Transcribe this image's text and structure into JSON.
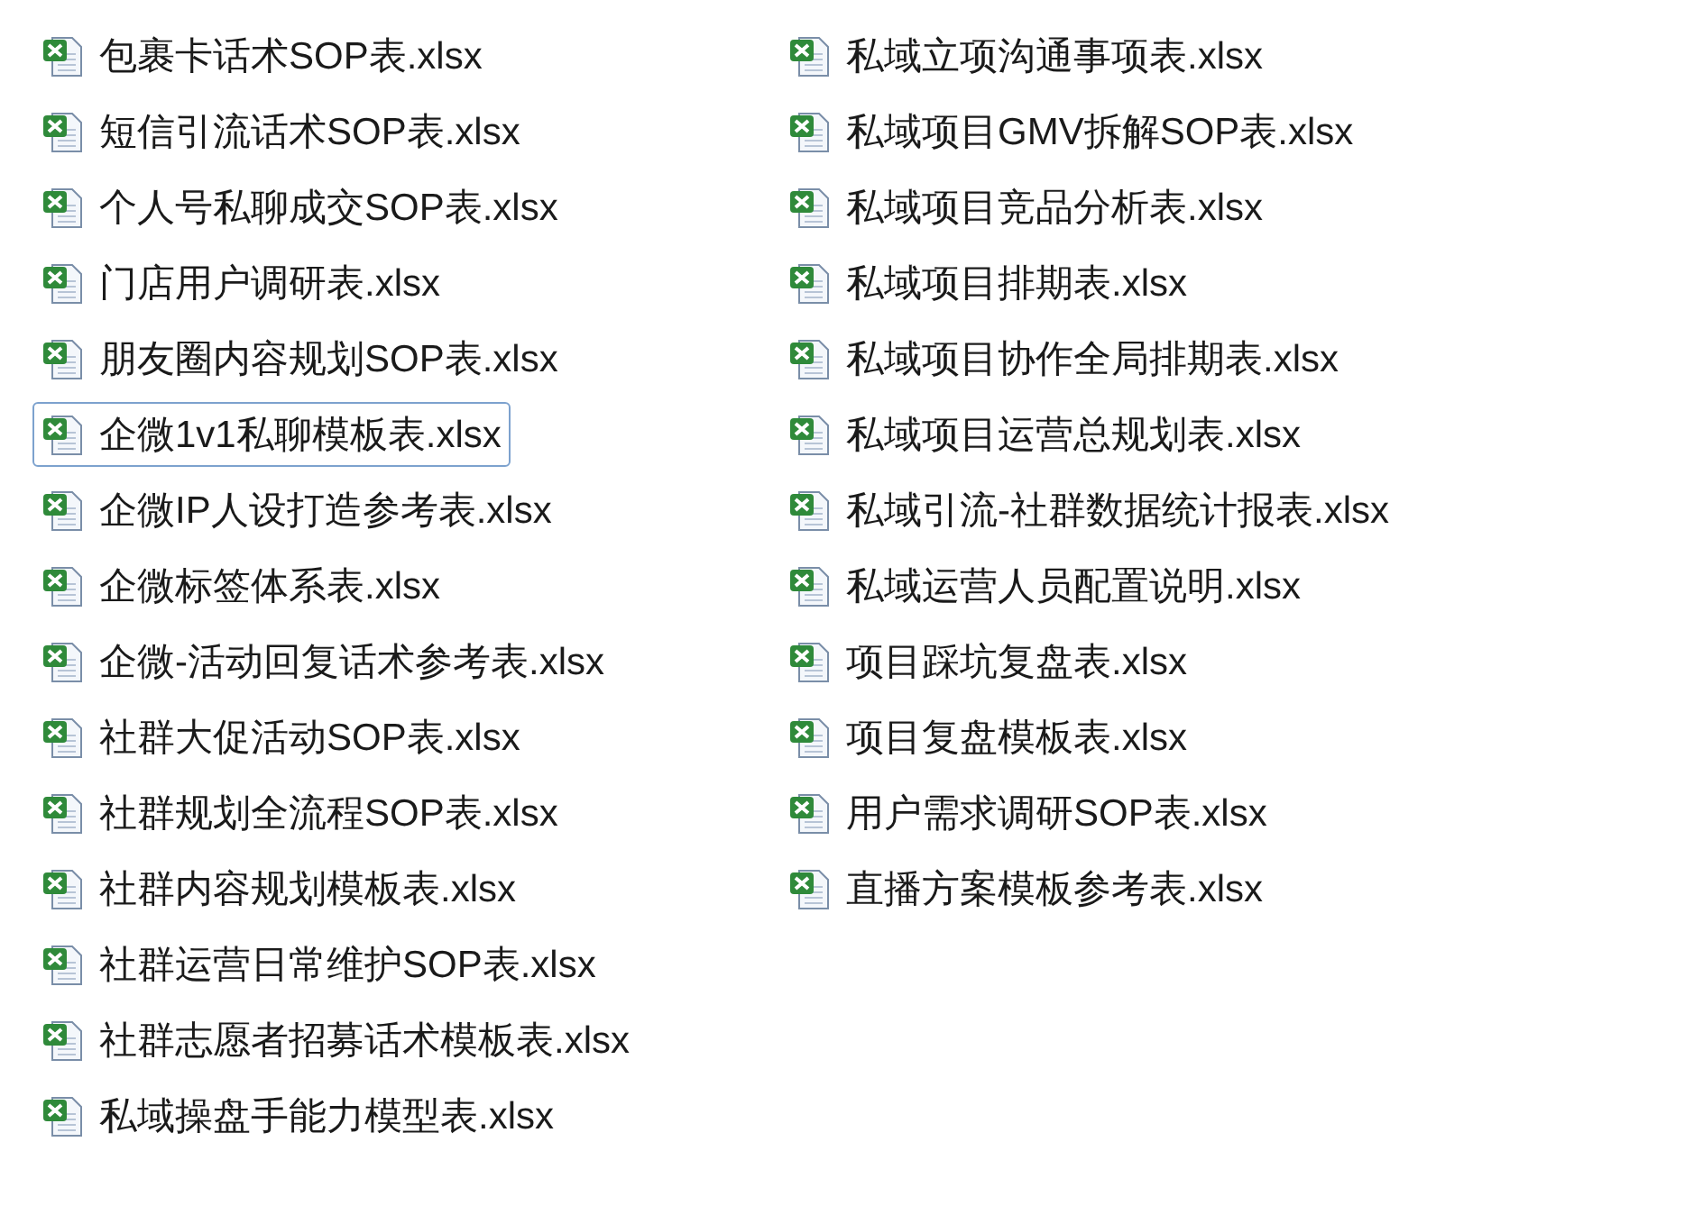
{
  "columns": [
    {
      "files": [
        {
          "name": "包裹卡话术SOP表.xlsx",
          "selected": false
        },
        {
          "name": "短信引流话术SOP表.xlsx",
          "selected": false
        },
        {
          "name": "个人号私聊成交SOP表.xlsx",
          "selected": false
        },
        {
          "name": "门店用户调研表.xlsx",
          "selected": false
        },
        {
          "name": "朋友圈内容规划SOP表.xlsx",
          "selected": false
        },
        {
          "name": "企微1v1私聊模板表.xlsx",
          "selected": true
        },
        {
          "name": "企微IP人设打造参考表.xlsx",
          "selected": false
        },
        {
          "name": "企微标签体系表.xlsx",
          "selected": false
        },
        {
          "name": "企微-活动回复话术参考表.xlsx",
          "selected": false
        },
        {
          "name": "社群大促活动SOP表.xlsx",
          "selected": false
        },
        {
          "name": "社群规划全流程SOP表.xlsx",
          "selected": false
        },
        {
          "name": "社群内容规划模板表.xlsx",
          "selected": false
        },
        {
          "name": "社群运营日常维护SOP表.xlsx",
          "selected": false
        },
        {
          "name": "社群志愿者招募话术模板表.xlsx",
          "selected": false
        },
        {
          "name": "私域操盘手能力模型表.xlsx",
          "selected": false
        }
      ]
    },
    {
      "files": [
        {
          "name": "私域立项沟通事项表.xlsx",
          "selected": false
        },
        {
          "name": "私域项目GMV拆解SOP表.xlsx",
          "selected": false
        },
        {
          "name": "私域项目竞品分析表.xlsx",
          "selected": false
        },
        {
          "name": "私域项目排期表.xlsx",
          "selected": false
        },
        {
          "name": "私域项目协作全局排期表.xlsx",
          "selected": false
        },
        {
          "name": "私域项目运营总规划表.xlsx",
          "selected": false
        },
        {
          "name": "私域引流-社群数据统计报表.xlsx",
          "selected": false
        },
        {
          "name": "私域运营人员配置说明.xlsx",
          "selected": false
        },
        {
          "name": "项目踩坑复盘表.xlsx",
          "selected": false
        },
        {
          "name": "项目复盘模板表.xlsx",
          "selected": false
        },
        {
          "name": "用户需求调研SOP表.xlsx",
          "selected": false
        },
        {
          "name": "直播方案模板参考表.xlsx",
          "selected": false
        }
      ]
    }
  ]
}
